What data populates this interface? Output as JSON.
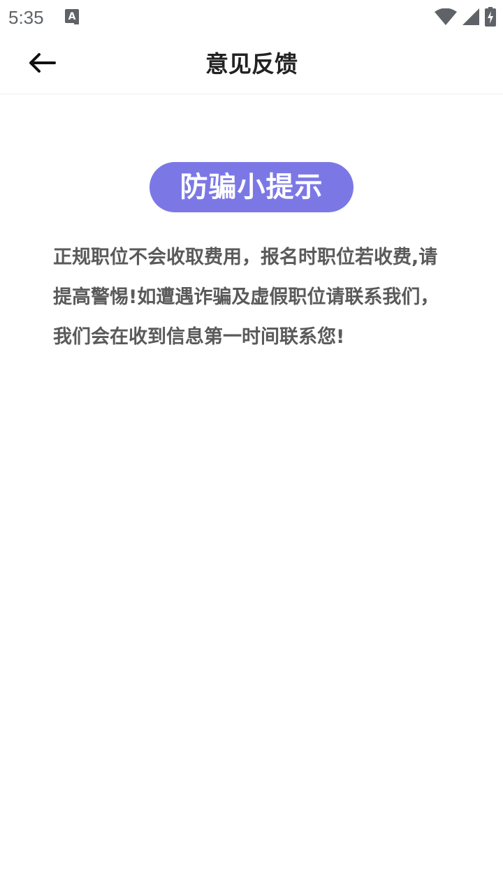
{
  "status_bar": {
    "time": "5:35",
    "icons": [
      "notification-a-icon",
      "wifi-icon",
      "cellular-signal-icon",
      "battery-charging-icon"
    ]
  },
  "app_bar": {
    "back_icon": "arrow-left-icon",
    "title": "意见反馈"
  },
  "content": {
    "badge_label": "防骗小提示",
    "badge_color": "#7b78e6",
    "notice_text": "正规职位不会收取费用，报名时职位若收费,请提高警惕!如遭遇诈骗及虚假职位请联系我们，我们会在收到信息第一时间联系您!"
  }
}
